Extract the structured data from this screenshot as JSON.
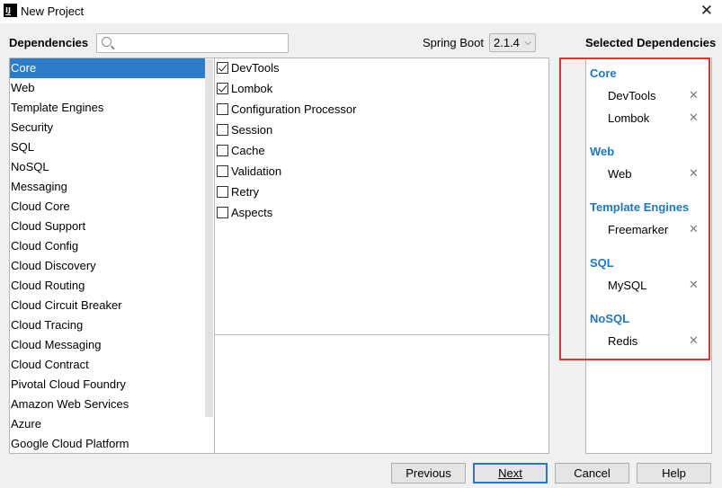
{
  "window": {
    "title": "New Project",
    "close_glyph": "✕"
  },
  "dependencies_label": "Dependencies",
  "search": {
    "value": "",
    "placeholder": "",
    "icon": "search-icon"
  },
  "spring_boot": {
    "label": "Spring Boot",
    "selected": "2.1.4"
  },
  "categories": [
    "Core",
    "Web",
    "Template Engines",
    "Security",
    "SQL",
    "NoSQL",
    "Messaging",
    "Cloud Core",
    "Cloud Support",
    "Cloud Config",
    "Cloud Discovery",
    "Cloud Routing",
    "Cloud Circuit Breaker",
    "Cloud Tracing",
    "Cloud Messaging",
    "Cloud Contract",
    "Pivotal Cloud Foundry",
    "Amazon Web Services",
    "Azure",
    "Google Cloud Platform"
  ],
  "selected_category": "Core",
  "deps": [
    {
      "label": "DevTools",
      "checked": true
    },
    {
      "label": "Lombok",
      "checked": true
    },
    {
      "label": "Configuration Processor",
      "checked": false
    },
    {
      "label": "Session",
      "checked": false
    },
    {
      "label": "Cache",
      "checked": false
    },
    {
      "label": "Validation",
      "checked": false
    },
    {
      "label": "Retry",
      "checked": false
    },
    {
      "label": "Aspects",
      "checked": false
    }
  ],
  "selected_dependencies": {
    "heading": "Selected Dependencies",
    "groups": [
      {
        "title": "Core",
        "items": [
          "DevTools",
          "Lombok"
        ]
      },
      {
        "title": "Web",
        "items": [
          "Web"
        ]
      },
      {
        "title": "Template Engines",
        "items": [
          "Freemarker"
        ]
      },
      {
        "title": "SQL",
        "items": [
          "MySQL"
        ]
      },
      {
        "title": "NoSQL",
        "items": [
          "Redis"
        ]
      }
    ],
    "remove_glyph": "✕"
  },
  "buttons": {
    "previous": "Previous",
    "next": "Next",
    "cancel": "Cancel",
    "help": "Help"
  },
  "colors": {
    "selection": "#2d7cc9",
    "group_title": "#1e77c4",
    "highlight_box": "#e0322d"
  }
}
